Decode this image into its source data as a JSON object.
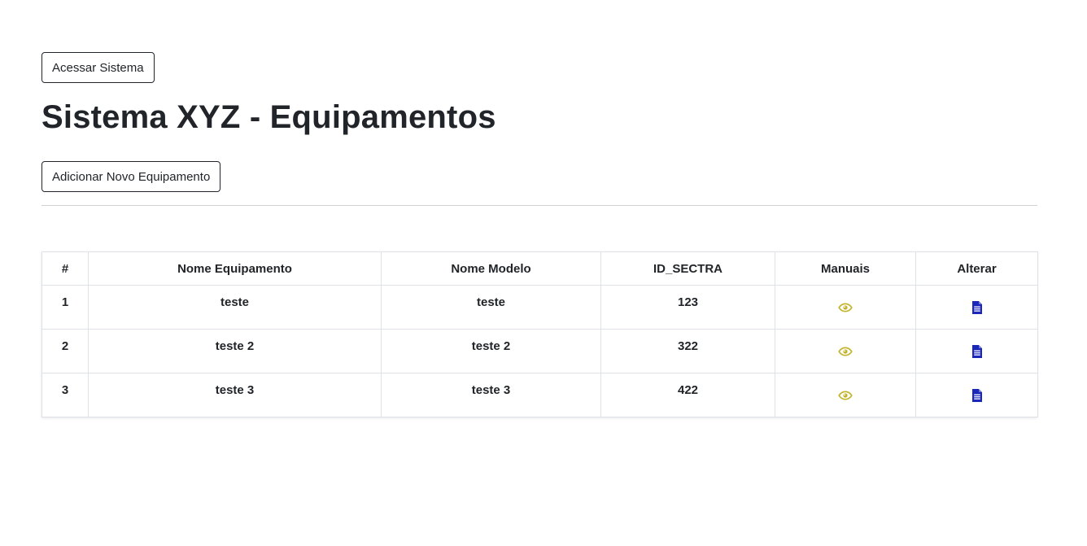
{
  "header": {
    "access_button_label": "Acessar Sistema",
    "title": "Sistema XYZ - Equipamentos",
    "add_button_label": "Adicionar Novo Equipamento"
  },
  "table": {
    "columns": [
      "#",
      "Nome Equipamento",
      "Nome Modelo",
      "ID_SECTRA",
      "Manuais",
      "Alterar"
    ],
    "rows": [
      {
        "num": "1",
        "equipamento": "teste",
        "modelo": "teste",
        "id_sectra": "123",
        "manuais_icon": "eye-icon",
        "alterar_icon": "document-icon"
      },
      {
        "num": "2",
        "equipamento": "teste 2",
        "modelo": "teste 2",
        "id_sectra": "322",
        "manuais_icon": "eye-icon",
        "alterar_icon": "document-icon"
      },
      {
        "num": "3",
        "equipamento": "teste 3",
        "modelo": "teste 3",
        "id_sectra": "422",
        "manuais_icon": "eye-icon",
        "alterar_icon": "document-icon"
      }
    ]
  },
  "colors": {
    "text": "#212529",
    "eye_icon": "#c4b22a",
    "document_icon": "#1b27b8",
    "border": "#dee2e6"
  }
}
